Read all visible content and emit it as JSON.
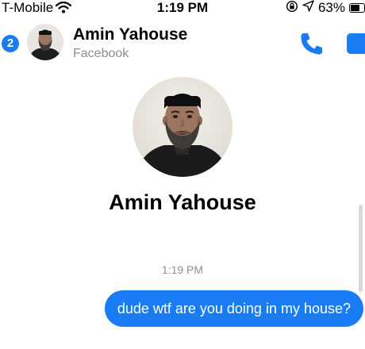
{
  "status_bar": {
    "carrier": "T-Mobile",
    "time": "1:19 PM",
    "battery": "63%",
    "icons": [
      "wifi-icon",
      "orientation-lock-icon",
      "location-arrow-icon",
      "battery-icon"
    ]
  },
  "header": {
    "back_badge_count": "2",
    "contact_name": "Amin Yahouse",
    "contact_subtitle": "Facebook",
    "icons": [
      "call-icon",
      "video-call-icon"
    ]
  },
  "profile": {
    "name": "Amin Yahouse"
  },
  "conversation": {
    "timestamp": "1:19 PM",
    "messages": [
      {
        "sender": "me",
        "text": "dude wtf are you doing in my house?"
      }
    ]
  },
  "colors": {
    "accent": "#1a7cf5",
    "secondary_text": "#8e8e93",
    "background": "#ffffff"
  }
}
